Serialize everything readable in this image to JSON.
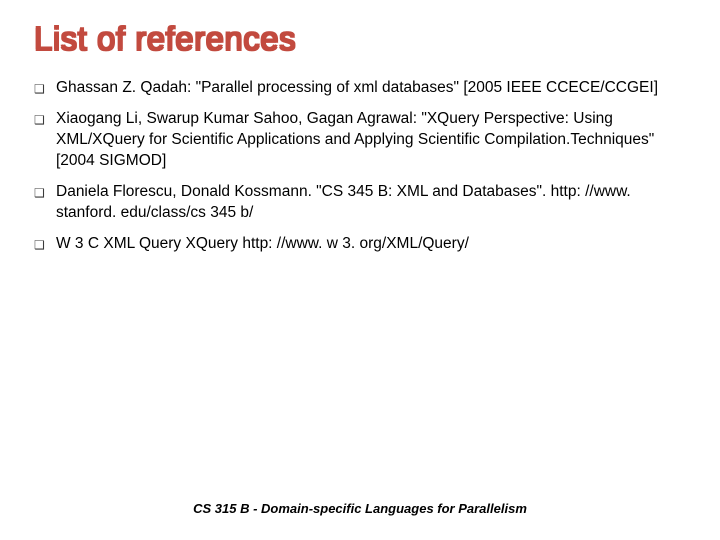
{
  "title": "List of references",
  "items": [
    "Ghassan Z. Qadah: \"Parallel processing of xml databases\" [2005 IEEE CCECE/CCGEI]",
    "Xiaogang Li, Swarup Kumar Sahoo, Gagan Agrawal: \"XQuery Perspective: Using XML/XQuery for Scientific Applications and Applying Scientific Compilation.Techniques\" [2004 SIGMOD]",
    "Daniela Florescu, Donald Kossmann. \"CS 345 B: XML and Databases\". http: //www. stanford. edu/class/cs 345 b/",
    "W 3 C XML Query XQuery http: //www. w 3. org/XML/Query/"
  ],
  "footer": "CS 315 B - Domain-specific Languages for Parallelism",
  "bullet_glyph": "❑"
}
